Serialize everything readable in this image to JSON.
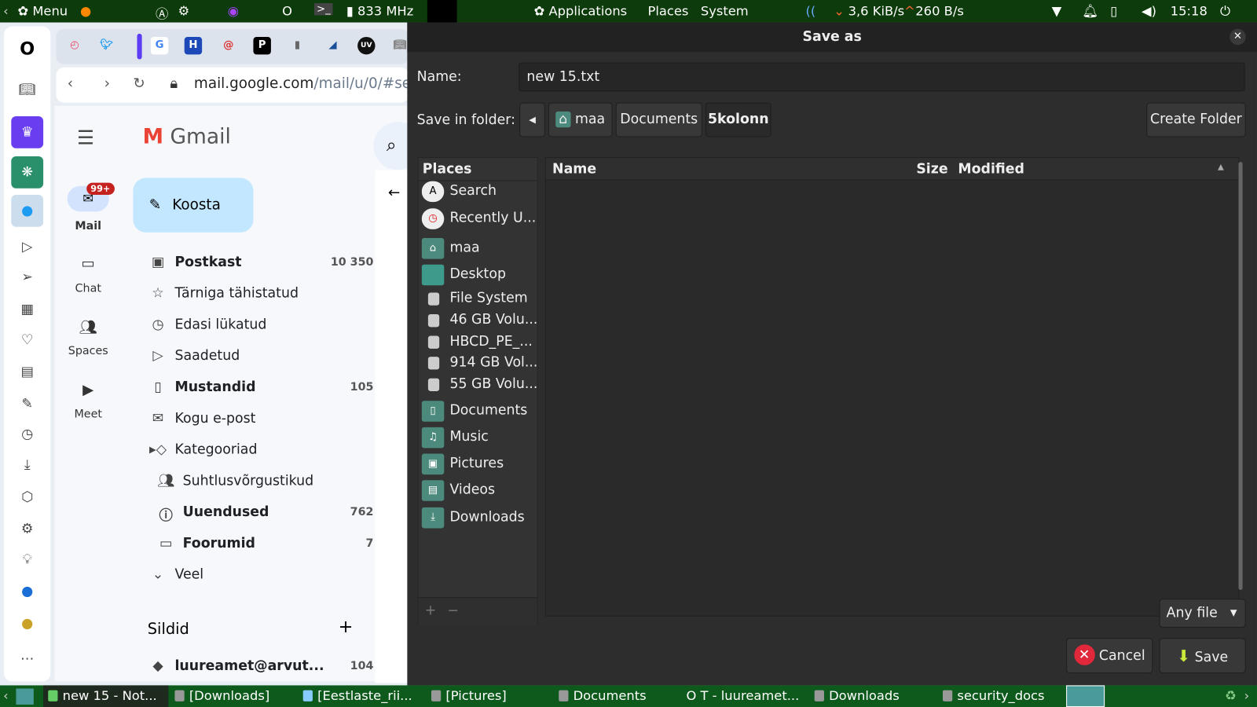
{
  "top_panel": {
    "menu": "Menu",
    "cpu": "833 MHz",
    "applications": "Applications",
    "places": "Places",
    "system": "System",
    "net_down": "3,6 KiB/s",
    "net_up": "260 B/s",
    "clock": "15:18"
  },
  "browser": {
    "url_host": "mail.google.com",
    "url_path": "/mail/u/0/#se"
  },
  "gmail": {
    "logo": "Gmail",
    "compose": "Koosta",
    "rail": [
      {
        "label": "Mail",
        "badge": "99+"
      },
      {
        "label": "Chat"
      },
      {
        "label": "Spaces"
      },
      {
        "label": "Meet"
      }
    ],
    "nav": [
      {
        "label": "Postkast",
        "count": "10 350",
        "bold": true
      },
      {
        "label": "Tärniga tähistatud",
        "count": ""
      },
      {
        "label": "Edasi lükatud",
        "count": ""
      },
      {
        "label": "Saadetud",
        "count": ""
      },
      {
        "label": "Mustandid",
        "count": "105",
        "bold": true
      },
      {
        "label": "Kogu e-post",
        "count": ""
      },
      {
        "label": "Kategooriad",
        "count": ""
      },
      {
        "label": "Suhtlusvõrgustikud",
        "count": ""
      },
      {
        "label": "Uuendused",
        "count": "762",
        "bold": true
      },
      {
        "label": "Foorumid",
        "count": "7",
        "bold": true
      },
      {
        "label": "Veel",
        "count": ""
      }
    ],
    "labels_title": "Sildid",
    "label_item": {
      "label": "luureamet@arvut...",
      "count": "104"
    }
  },
  "dialog": {
    "title": "Save as",
    "name_label": "Name:",
    "name_value": "new 15.txt",
    "folder_label": "Save in folder:",
    "path": [
      "maa",
      "Documents",
      "5kolonn"
    ],
    "create_folder": "Create Folder",
    "places_header": "Places",
    "places": [
      "Search",
      "Recently U...",
      "maa",
      "Desktop",
      "File System",
      "46 GB Volu...",
      "HBCD_PE_...",
      "914 GB Vol...",
      "55 GB Volu...",
      "Documents",
      "Music",
      "Pictures",
      "Videos",
      "Downloads"
    ],
    "columns": {
      "name": "Name",
      "size": "Size",
      "modified": "Modified"
    },
    "filter": "Any file",
    "cancel": "Cancel",
    "save": "Save"
  },
  "taskbar": [
    "new 15 - Not...",
    "[Downloads]",
    "[Eestlaste_rii...",
    "[Pictures]",
    "Documents",
    "T - luureamet...",
    "Downloads",
    "security_docs"
  ]
}
